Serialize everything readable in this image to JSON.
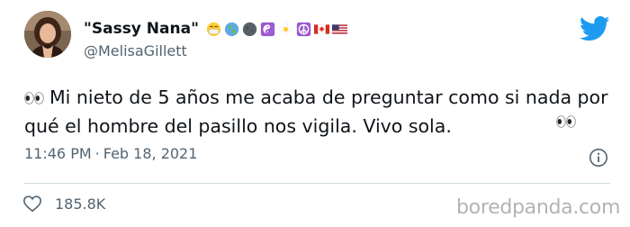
{
  "author": {
    "display_name": "\"Sassy Nana\"",
    "handle": "@MelisaGillett",
    "name_emojis": [
      "face-mask-icon",
      "globe-icon",
      "new-moon-icon",
      "yin-yang-icon",
      "daisy-icon",
      "peace-icon",
      "canada-flag-icon",
      "usa-flag-icon"
    ]
  },
  "tweet": {
    "text": "Mi nieto de 5 años me acaba de preguntar como si nada por qué el hombre del pasillo nos vigila. Vivo sola.",
    "time": "11:46 PM",
    "separator": "·",
    "date": "Feb 18, 2021",
    "likes": "185.8K"
  },
  "watermark": "boredpanda.com",
  "colors": {
    "text": "#0f1419",
    "secondary": "#536471",
    "twitter_blue": "#1d9bf0",
    "divider": "#cfd9de",
    "watermark": "#b3b3b3"
  }
}
